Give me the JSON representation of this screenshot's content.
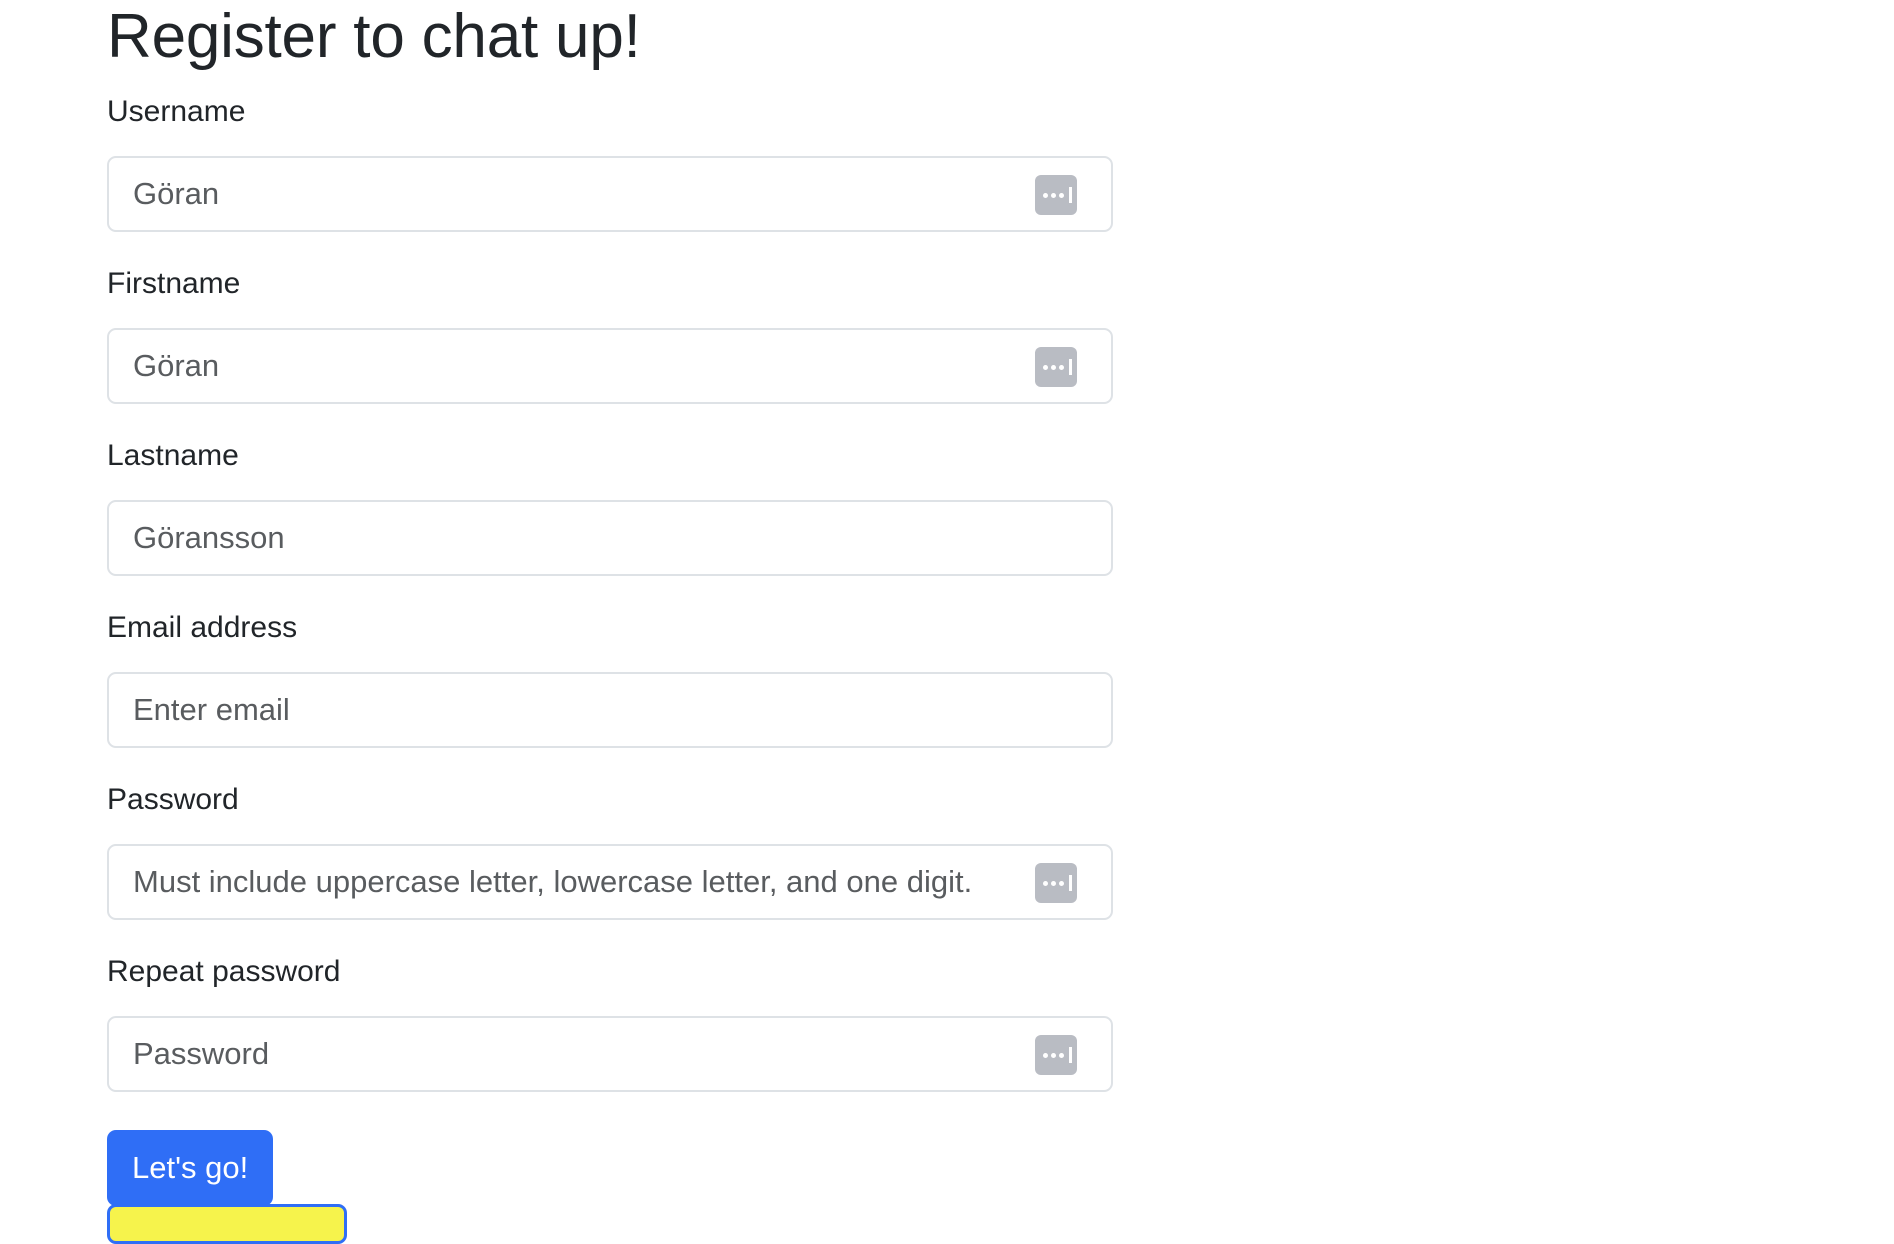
{
  "page": {
    "title": "Register to chat up!"
  },
  "form": {
    "fields": [
      {
        "label": "Username",
        "value": "Göran",
        "placeholder": "",
        "autofill_icon": "password-autofill-icon"
      },
      {
        "label": "Firstname",
        "value": "Göran",
        "placeholder": "",
        "autofill_icon": "password-autofill-icon"
      },
      {
        "label": "Lastname",
        "value": "Göransson",
        "placeholder": ""
      },
      {
        "label": "Email address",
        "value": "",
        "placeholder": "Enter email"
      },
      {
        "label": "Password",
        "value": "",
        "placeholder": "Must include uppercase letter, lowercase letter, and one digit.",
        "autofill_icon": "password-autofill-icon"
      },
      {
        "label": "Repeat password",
        "value": "",
        "placeholder": "Password",
        "autofill_icon": "password-autofill-icon"
      }
    ],
    "submit_label": "Let's go!"
  },
  "colors": {
    "primary": "#2f6ef6",
    "secondary_button_fill": "#f6f34c",
    "autofill_icon": "#b9bcc3",
    "input_border": "#dee2e6",
    "text": "#212529"
  }
}
